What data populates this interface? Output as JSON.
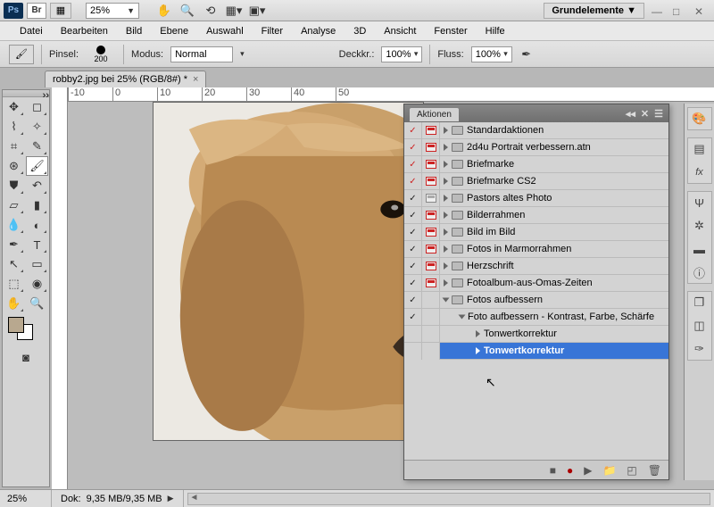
{
  "titlebar": {
    "zoom": "25%",
    "workspace": "Grundelemente"
  },
  "menu": [
    "Datei",
    "Bearbeiten",
    "Bild",
    "Ebene",
    "Auswahl",
    "Filter",
    "Analyse",
    "3D",
    "Ansicht",
    "Fenster",
    "Hilfe"
  ],
  "options": {
    "brush_label": "Pinsel:",
    "brush_size": "200",
    "mode_label": "Modus:",
    "mode_value": "Normal",
    "opacity_label": "Deckkr.:",
    "opacity_value": "100%",
    "flow_label": "Fluss:",
    "flow_value": "100%"
  },
  "doctab": {
    "title": "robby2.jpg bei 25% (RGB/8#) *"
  },
  "ruler_h": [
    "-10",
    "0",
    "10",
    "20",
    "30",
    "40",
    "50"
  ],
  "actions": {
    "panel_title": "Aktionen",
    "items": [
      {
        "chk": "red",
        "dlg": "red",
        "type": "folder",
        "label": "Standardaktionen"
      },
      {
        "chk": "red",
        "dlg": "red",
        "type": "folder",
        "label": "2d4u Portrait verbessern.atn"
      },
      {
        "chk": "red",
        "dlg": "red",
        "type": "folder",
        "label": "Briefmarke"
      },
      {
        "chk": "red",
        "dlg": "red",
        "type": "folder",
        "label": "Briefmarke CS2"
      },
      {
        "chk": "on",
        "dlg": "off",
        "type": "folder",
        "label": "Pastors altes Photo"
      },
      {
        "chk": "on",
        "dlg": "red",
        "type": "folder",
        "label": "Bilderrahmen"
      },
      {
        "chk": "on",
        "dlg": "red",
        "type": "folder",
        "label": "Bild im Bild"
      },
      {
        "chk": "on",
        "dlg": "red",
        "type": "folder",
        "label": "Fotos in Marmorrahmen"
      },
      {
        "chk": "on",
        "dlg": "red",
        "type": "folder",
        "label": "Herzschrift"
      },
      {
        "chk": "on",
        "dlg": "red",
        "type": "folder",
        "label": "Fotoalbum-aus-Omas-Zeiten"
      },
      {
        "chk": "on",
        "dlg": "",
        "type": "folder-open",
        "label": "Fotos aufbessern"
      },
      {
        "chk": "on",
        "dlg": "",
        "type": "action-open",
        "indent": 1,
        "label": "Foto aufbessern - Kontrast, Farbe, Schärfe"
      },
      {
        "chk": "",
        "dlg": "",
        "type": "step",
        "indent": 2,
        "label": "Tonwertkorrektur"
      },
      {
        "chk": "",
        "dlg": "",
        "type": "step",
        "indent": 2,
        "label": "Tonwertkorrektur",
        "selected": true
      }
    ]
  },
  "status": {
    "zoom": "25%",
    "doc_label": "Dok:",
    "doc_value": "9,35 MB/9,35 MB"
  }
}
